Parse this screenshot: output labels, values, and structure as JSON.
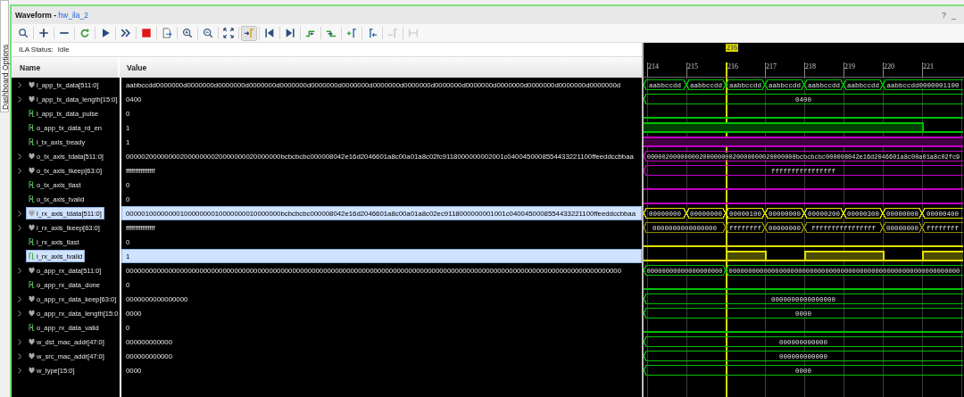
{
  "side_tab": {
    "label": "Dashboard Options",
    "selected": false
  },
  "window": {
    "title": "Waveform - ",
    "source": "hw_ila_2",
    "help": "?",
    "minimize": "_"
  },
  "toolbar": [
    {
      "kind": "search",
      "pressed": false,
      "disabled": false
    },
    {
      "kind": "add",
      "pressed": false,
      "disabled": false
    },
    {
      "kind": "remove",
      "pressed": false,
      "disabled": false
    },
    {
      "kind": "refresh",
      "pressed": false,
      "disabled": false
    },
    {
      "kind": "run",
      "pressed": false,
      "disabled": false
    },
    {
      "kind": "run_all",
      "pressed": false,
      "disabled": false
    },
    {
      "kind": "stop",
      "pressed": false,
      "disabled": false
    },
    {
      "kind": "export",
      "pressed": false,
      "disabled": false
    },
    {
      "kind": "zoom_in",
      "pressed": false,
      "disabled": false
    },
    {
      "kind": "zoom_out",
      "pressed": false,
      "disabled": false
    },
    {
      "kind": "fit",
      "pressed": false,
      "disabled": false
    },
    {
      "kind": "snap",
      "pressed": true,
      "disabled": false
    },
    {
      "kind": "first",
      "pressed": false,
      "disabled": false
    },
    {
      "kind": "last",
      "pressed": false,
      "disabled": false
    },
    {
      "kind": "prev_transition",
      "pressed": false,
      "disabled": false
    },
    {
      "kind": "next_transition",
      "pressed": false,
      "disabled": false
    },
    {
      "kind": "add_marker",
      "pressed": false,
      "disabled": false
    },
    {
      "kind": "prev_marker",
      "pressed": false,
      "disabled": false
    },
    {
      "kind": "next_marker",
      "pressed": false,
      "disabled": true
    },
    {
      "kind": "marker_range",
      "pressed": false,
      "disabled": true
    }
  ],
  "ila_status": {
    "label": "ILA Status:",
    "value": "Idle"
  },
  "columns": [
    "Name",
    "Value"
  ],
  "timeline": {
    "cursor_label": "216",
    "ticks": [
      {
        "label": "214",
        "cursor": false
      },
      {
        "label": "215",
        "cursor": false
      },
      {
        "label": "216",
        "cursor": true
      },
      {
        "label": "217",
        "cursor": false
      },
      {
        "label": "218",
        "cursor": false
      },
      {
        "label": "219",
        "cursor": false
      },
      {
        "label": "220",
        "cursor": false
      },
      {
        "label": "221",
        "cursor": false
      }
    ]
  },
  "rows": [
    {
      "name": "i_app_tx_data[511:0]",
      "kind": "bus",
      "expanded": false,
      "selected": false,
      "color": "#00c000",
      "value": "aabbccdd0000000d0000000d0000000d0000000d0000000d0000000d0000000d0000000d0000000d0000000d0000000d0000000d0000000d0000000d0000000d",
      "cells": [
        {
          "text": "aabbccdd",
          "joined": false
        },
        {
          "text": "aabbccdd",
          "joined": false
        },
        {
          "text": "aabbccdd",
          "joined": false
        },
        {
          "text": "aabbccdd",
          "joined": false
        },
        {
          "text": "aabbccdd",
          "joined": false
        },
        {
          "text": "aabbccdd",
          "joined": false
        },
        {
          "text": "aabbccdd0000001100",
          "joined": false
        },
        {
          "joined": true
        }
      ]
    },
    {
      "name": "i_app_tx_data_length[15:0]",
      "kind": "bus",
      "expanded": false,
      "selected": false,
      "color": "#00c000",
      "value": "0400",
      "cells": [
        {
          "text": "0400",
          "joined": false
        },
        {
          "joined": true
        },
        {
          "joined": true
        },
        {
          "joined": true
        },
        {
          "joined": true
        },
        {
          "joined": true
        },
        {
          "joined": true
        },
        {
          "joined": true
        }
      ]
    },
    {
      "name": "i_app_tx_data_pulse",
      "kind": "bit",
      "selected": false,
      "color": "#00c000",
      "value": "0",
      "cells": [
        {
          "high": false
        },
        {
          "high": false
        },
        {
          "high": false
        },
        {
          "high": false
        },
        {
          "high": false
        },
        {
          "high": false
        },
        {
          "high": false
        },
        {
          "high": false
        }
      ]
    },
    {
      "name": "o_app_tx_data_rd_en",
      "kind": "bit",
      "selected": false,
      "color": "#00c000",
      "value": "1",
      "cells": [
        {
          "high": true
        },
        {
          "high": true
        },
        {
          "high": true
        },
        {
          "high": true
        },
        {
          "high": true
        },
        {
          "high": true
        },
        {
          "high": true
        },
        {
          "high": false
        }
      ]
    },
    {
      "name": "i_tx_axis_tready",
      "kind": "bit",
      "selected": false,
      "color": "#c000c0",
      "value": "1",
      "cells": [
        {
          "high": true
        },
        {
          "high": true
        },
        {
          "high": true
        },
        {
          "high": true
        },
        {
          "high": true
        },
        {
          "high": true
        },
        {
          "high": true
        },
        {
          "high": true
        }
      ]
    },
    {
      "name": "o_tx_axis_tdata[511:0]",
      "kind": "bus",
      "expanded": false,
      "selected": false,
      "color": "#c000c0",
      "value": "0000020000000020000000020000000020000000bcbcbcbc000008042e16d2046601a8c00a01a8c02fc9118000000002001c0400450008554433221100ffeeddccbbaa",
      "cells": [
        {
          "text": "0000020000000020000000020000000020000000bcbcbcbc000008042e16d2046601a8c00a01a8c02fc9",
          "joined": false
        },
        {
          "joined": true
        },
        {
          "joined": true
        },
        {
          "joined": true
        },
        {
          "joined": true
        },
        {
          "joined": true
        },
        {
          "joined": true
        },
        {
          "joined": true
        }
      ]
    },
    {
      "name": "o_tx_axis_tkeep[63:0]",
      "kind": "bus",
      "expanded": false,
      "selected": false,
      "color": "#c000c0",
      "value": "ffffffffffffffff",
      "cells": [
        {
          "text": "ffffffffffffffff",
          "joined": false
        },
        {
          "joined": true
        },
        {
          "joined": true
        },
        {
          "joined": true
        },
        {
          "joined": true
        },
        {
          "joined": true
        },
        {
          "joined": true
        },
        {
          "joined": true
        }
      ]
    },
    {
      "name": "o_tx_axis_tlast",
      "kind": "bit",
      "selected": false,
      "color": "#c000c0",
      "value": "0",
      "cells": [
        {
          "high": false
        },
        {
          "high": false
        },
        {
          "high": false
        },
        {
          "high": false
        },
        {
          "high": false
        },
        {
          "high": false
        },
        {
          "high": false
        },
        {
          "high": false
        }
      ]
    },
    {
      "name": "o_tx_axis_tvalid",
      "kind": "bit",
      "selected": false,
      "color": "#c000c0",
      "value": "0",
      "cells": [
        {
          "high": false
        },
        {
          "high": false
        },
        {
          "high": false
        },
        {
          "high": false
        },
        {
          "high": false
        },
        {
          "high": false
        },
        {
          "high": false
        },
        {
          "high": false
        }
      ]
    },
    {
      "name": "i_rx_axis_tdata[511:0]",
      "kind": "bus",
      "expanded": false,
      "selected": true,
      "color": "#e0e000",
      "value": "0000010000000010000000010000000010000000bcbcbcbc000008042e16d2046601a8c00a01a8c02ec9118000000001001c0400450008554433221100ffeeddccbbaa",
      "cells": [
        {
          "text": "00000000",
          "joined": false
        },
        {
          "text": "00000000",
          "joined": false
        },
        {
          "text": "00000100",
          "joined": false
        },
        {
          "text": "00000000",
          "joined": false
        },
        {
          "text": "00000200",
          "joined": false
        },
        {
          "text": "00000300",
          "joined": false
        },
        {
          "text": "00000000",
          "joined": false
        },
        {
          "text": "00000400",
          "joined": false
        }
      ]
    },
    {
      "name": "i_rx_axis_tkeep[63:0]",
      "kind": "bus",
      "expanded": false,
      "selected": false,
      "color": "#8a8a00",
      "value": "ffffffffffffffff",
      "cells": [
        {
          "text": "0000000000000000",
          "joined": false
        },
        {
          "joined": true
        },
        {
          "text": "ffffffff",
          "joined": false
        },
        {
          "text": "00000000",
          "joined": false
        },
        {
          "text": "ffffffffffffffff",
          "joined": false
        },
        {
          "joined": true
        },
        {
          "text": "00000000",
          "joined": false
        },
        {
          "text": "ffffffff",
          "joined": false
        }
      ]
    },
    {
      "name": "i_rx_axis_tlast",
      "kind": "bit",
      "selected": false,
      "color": "#e0e000",
      "value": "0",
      "cells": [
        {
          "high": false
        },
        {
          "high": false
        },
        {
          "high": false
        },
        {
          "high": false
        },
        {
          "high": false
        },
        {
          "high": false
        },
        {
          "high": false
        },
        {
          "high": false
        }
      ]
    },
    {
      "name": "i_rx_axis_tvalid",
      "kind": "bit",
      "selected": true,
      "color": "#e0e000",
      "value": "1",
      "cells": [
        {
          "high": false
        },
        {
          "high": false
        },
        {
          "high": true
        },
        {
          "high": false
        },
        {
          "high": true
        },
        {
          "high": true
        },
        {
          "high": false
        },
        {
          "high": true
        }
      ]
    },
    {
      "name": "o_app_rx_data[511:0]",
      "kind": "bus",
      "expanded": false,
      "selected": false,
      "color": "#00c000",
      "value": "00000000000000000000000000000000000000000000000000000000000000000000000000000000000000000000000000000000000000000000000000000000",
      "cells": [
        {
          "text": "00000000000000000000",
          "joined": false
        },
        {
          "joined": true
        },
        {
          "text": "000000000000000000000000000000000000000000000000000000000000",
          "joined": false
        },
        {
          "joined": true
        },
        {
          "joined": true
        },
        {
          "joined": true
        },
        {
          "joined": true
        },
        {
          "joined": true
        }
      ]
    },
    {
      "name": "o_app_rx_data_done",
      "kind": "bit",
      "selected": false,
      "color": "#00c000",
      "value": "0",
      "cells": [
        {
          "high": false
        },
        {
          "high": false
        },
        {
          "high": false
        },
        {
          "high": false
        },
        {
          "high": false
        },
        {
          "high": false
        },
        {
          "high": false
        },
        {
          "high": false
        }
      ]
    },
    {
      "name": "o_app_rx_data_keep[63:0]",
      "kind": "bus",
      "expanded": false,
      "selected": false,
      "color": "#00c000",
      "value": "0000000000000000",
      "cells": [
        {
          "text": "0000000000000000",
          "joined": false
        },
        {
          "joined": true
        },
        {
          "joined": true
        },
        {
          "joined": true
        },
        {
          "joined": true
        },
        {
          "joined": true
        },
        {
          "joined": true
        },
        {
          "joined": true
        }
      ]
    },
    {
      "name": "o_app_rx_data_length[15:0",
      "kind": "bus",
      "expanded": false,
      "selected": false,
      "color": "#00c000",
      "value": "0000",
      "cells": [
        {
          "text": "0000",
          "joined": false
        },
        {
          "joined": true
        },
        {
          "joined": true
        },
        {
          "joined": true
        },
        {
          "joined": true
        },
        {
          "joined": true
        },
        {
          "joined": true
        },
        {
          "joined": true
        }
      ]
    },
    {
      "name": "o_app_rx_data_valid",
      "kind": "bit",
      "selected": false,
      "color": "#00c000",
      "value": "0",
      "cells": [
        {
          "high": false
        },
        {
          "high": false
        },
        {
          "high": false
        },
        {
          "high": false
        },
        {
          "high": false
        },
        {
          "high": false
        },
        {
          "high": false
        },
        {
          "high": false
        }
      ]
    },
    {
      "name": "w_dst_mac_addr[47:0]",
      "kind": "bus",
      "expanded": false,
      "selected": false,
      "color": "#00c000",
      "value": "000000000000",
      "cells": [
        {
          "text": "000000000000",
          "joined": false
        },
        {
          "joined": true
        },
        {
          "joined": true
        },
        {
          "joined": true
        },
        {
          "joined": true
        },
        {
          "joined": true
        },
        {
          "joined": true
        },
        {
          "joined": true
        }
      ]
    },
    {
      "name": "w_src_mac_addr[47:0]",
      "kind": "bus",
      "expanded": false,
      "selected": false,
      "color": "#00c000",
      "value": "000000000000",
      "cells": [
        {
          "text": "000000000000",
          "joined": false
        },
        {
          "joined": true
        },
        {
          "joined": true
        },
        {
          "joined": true
        },
        {
          "joined": true
        },
        {
          "joined": true
        },
        {
          "joined": true
        },
        {
          "joined": true
        }
      ]
    },
    {
      "name": "w_type[15:0]",
      "kind": "bus",
      "expanded": false,
      "selected": false,
      "color": "#00c000",
      "value": "0000",
      "cells": [
        {
          "text": "0000",
          "joined": false
        },
        {
          "joined": true
        },
        {
          "joined": true
        },
        {
          "joined": true
        },
        {
          "joined": true
        },
        {
          "joined": true
        },
        {
          "joined": true
        },
        {
          "joined": true
        }
      ]
    }
  ]
}
